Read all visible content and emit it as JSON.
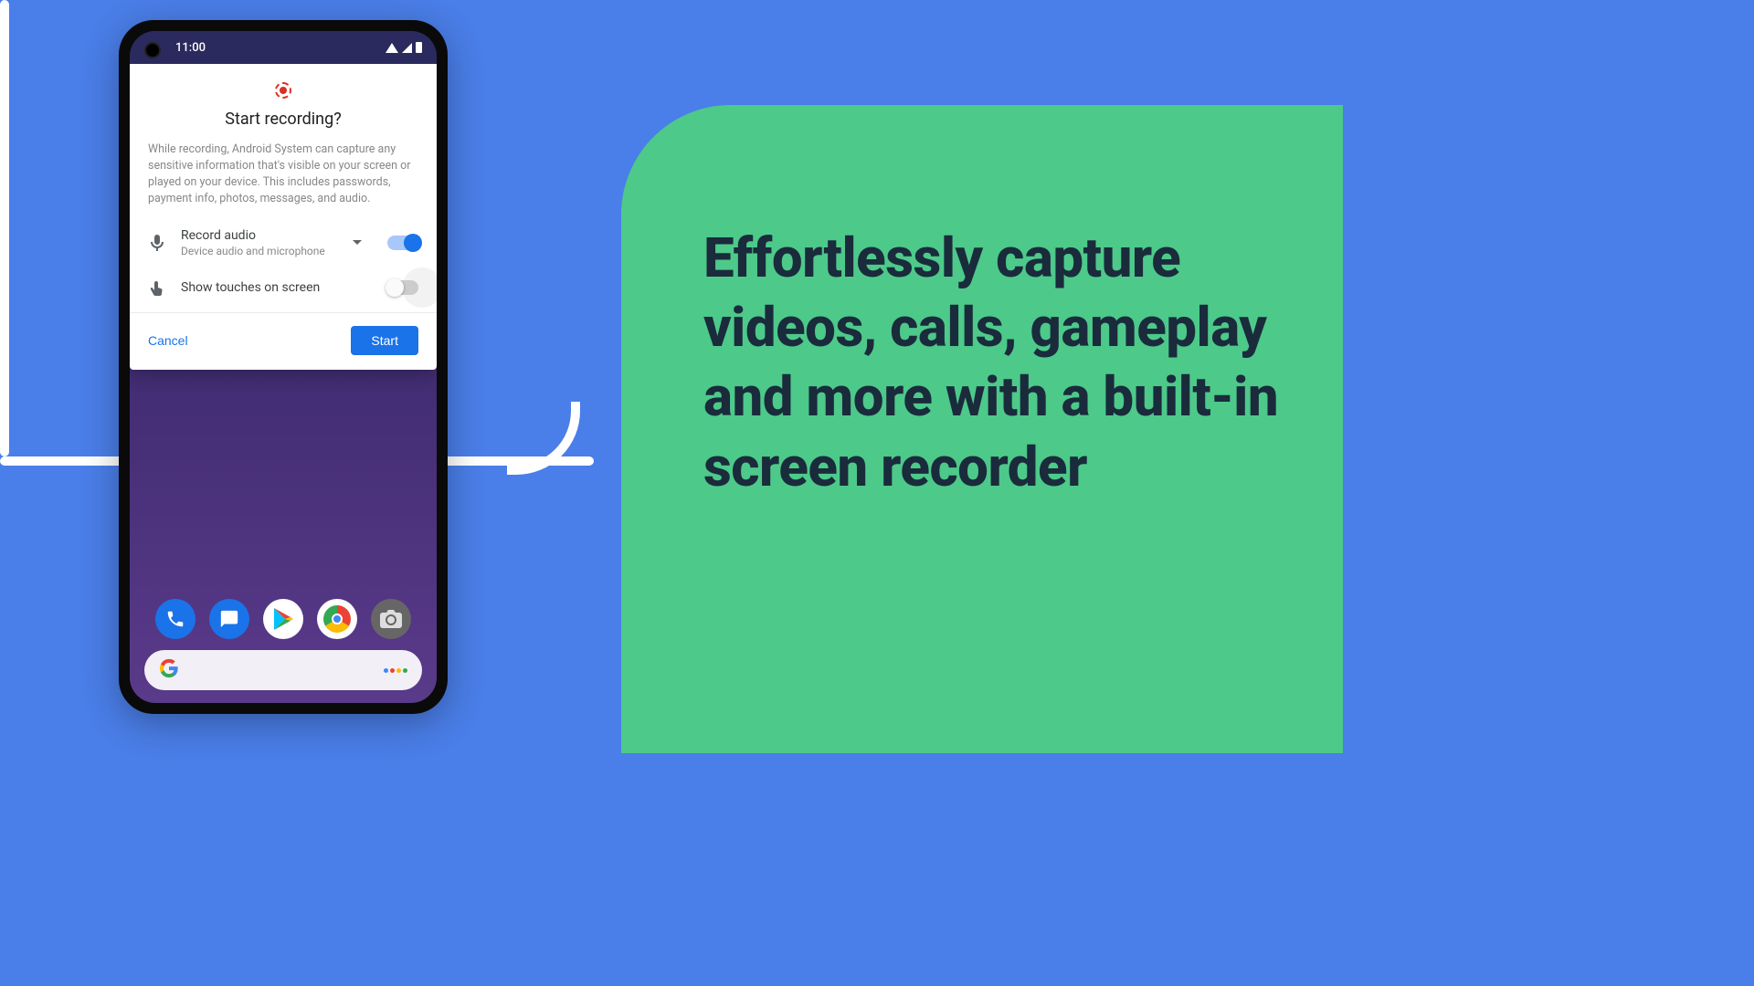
{
  "headline": "Effortlessly capture videos, calls, gameplay and more with a built-in screen recorder",
  "statusbar": {
    "time": "11:00"
  },
  "dialog": {
    "title": "Start recording?",
    "body": "While recording, Android System can capture any sensitive information that's visible on your screen or played on your device. This includes passwords, payment info, photos, messages, and audio.",
    "audio": {
      "label": "Record audio",
      "sub": "Device audio and microphone",
      "enabled": true
    },
    "touches": {
      "label": "Show touches on screen",
      "enabled": false
    },
    "cancel": "Cancel",
    "start": "Start"
  },
  "dock": {
    "items": [
      "phone",
      "messages",
      "play-store",
      "chrome",
      "camera"
    ]
  }
}
